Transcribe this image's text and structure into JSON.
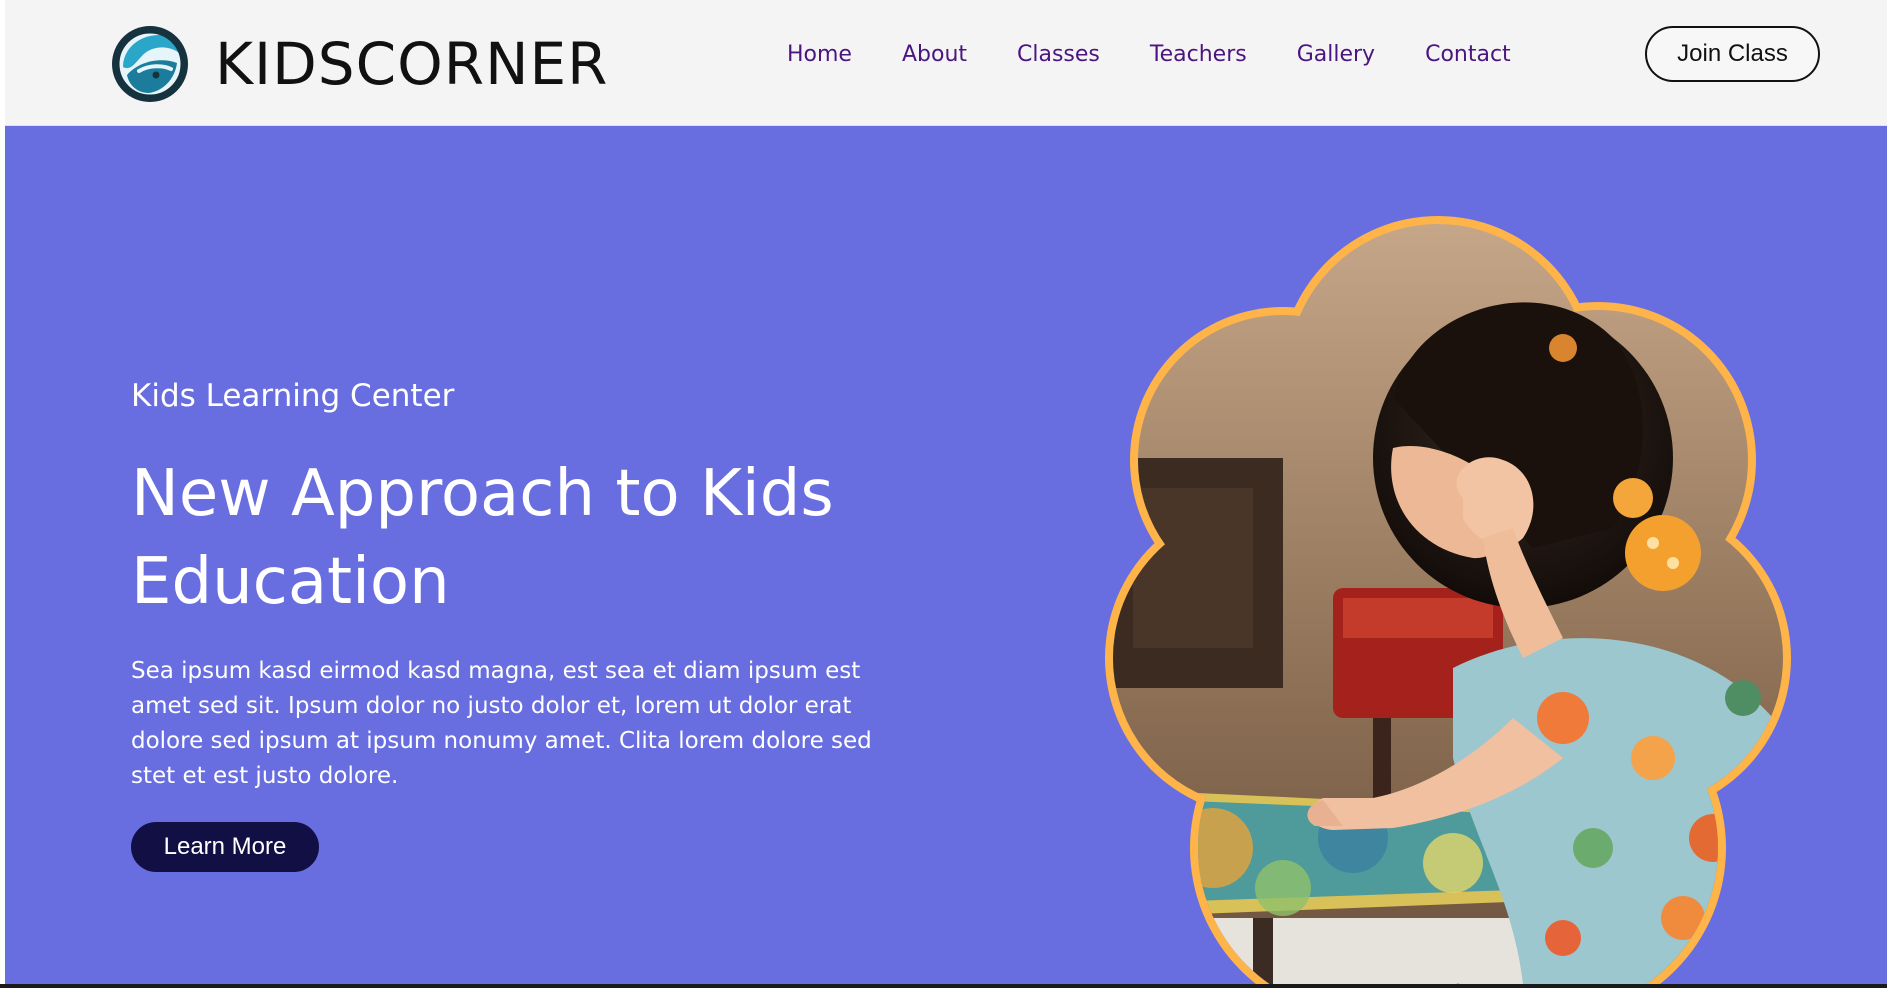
{
  "brand": {
    "name": "KIDSCORNER",
    "logo_icon": "globe-swirl-icon"
  },
  "nav": {
    "items": [
      {
        "label": "Home"
      },
      {
        "label": "About"
      },
      {
        "label": "Classes"
      },
      {
        "label": "Teachers"
      },
      {
        "label": "Gallery"
      },
      {
        "label": "Contact"
      }
    ]
  },
  "header": {
    "cta_label": "Join Class"
  },
  "hero": {
    "eyebrow": "Kids Learning Center",
    "headline": "New Approach to Kids Education",
    "description": "Sea ipsum kasd eirmod kasd magna, est sea et diam ipsum est amet sed sit. Ipsum dolor no justo dolor et, lorem ut dolor erat dolore sed ipsum at ipsum nonumy amet. Clita lorem dolore sed stet et est justo dolore.",
    "button_label": "Learn More",
    "image_icon": "child-with-puzzle-photo"
  },
  "colors": {
    "header_bg": "#f4f4f4",
    "hero_bg": "#686de0",
    "nav_link": "#4b1580",
    "learn_button_bg": "#120f45",
    "image_border": "#ffb74d"
  }
}
